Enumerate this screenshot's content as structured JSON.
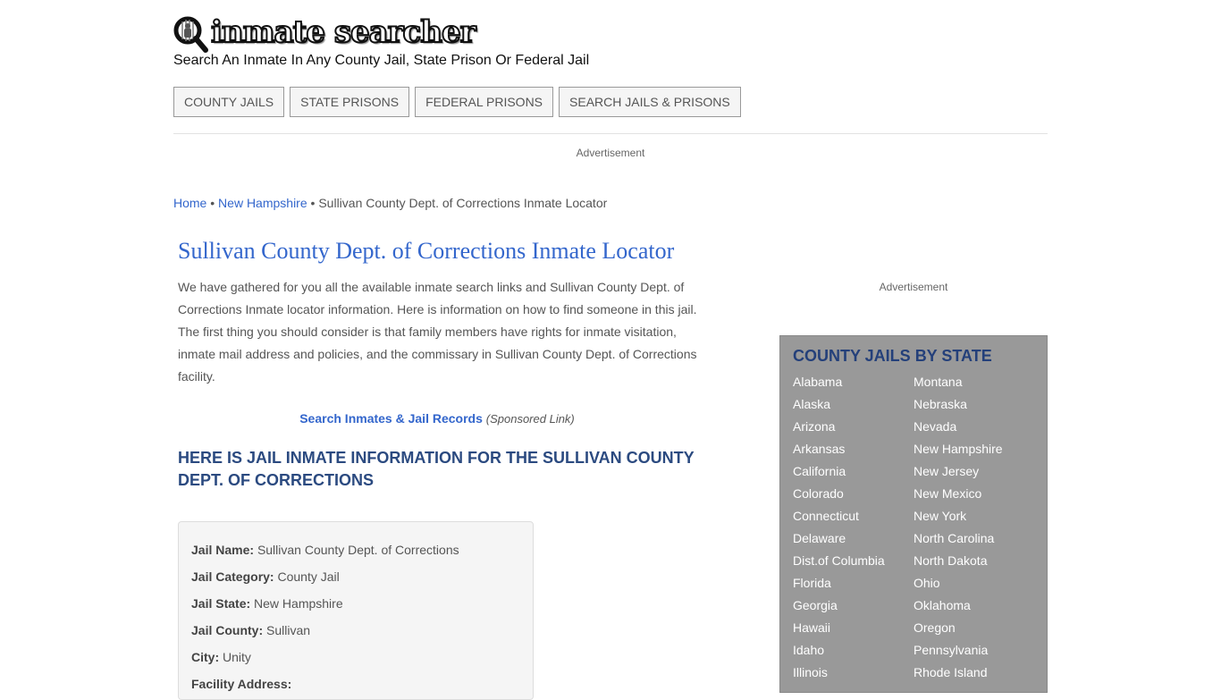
{
  "header": {
    "logo_text": "inmate searcher",
    "tagline": "Search An Inmate In Any County Jail, State Prison Or Federal Jail"
  },
  "nav": {
    "items": [
      "COUNTY JAILS",
      "STATE PRISONS",
      "FEDERAL PRISONS",
      "SEARCH JAILS & PRISONS"
    ]
  },
  "ads": {
    "top_label": "Advertisement",
    "side_label": "Advertisement"
  },
  "breadcrumb": {
    "home": "Home",
    "state": "New Hampshire",
    "separator": "•",
    "current": "Sullivan County Dept. of Corrections Inmate Locator"
  },
  "main": {
    "title": "Sullivan County Dept. of Corrections Inmate Locator",
    "intro": "We have gathered for you all the available inmate search links and Sullivan County Dept. of Corrections Inmate locator information. Here is information on how to find someone in this jail. The first thing you should consider is that family members have rights for inmate visitation, inmate mail address and policies, and the commissary in Sullivan County Dept. of Corrections facility.",
    "sponsored_link": "Search Inmates & Jail Records",
    "sponsored_note": "(Sponsored Link)",
    "section_heading": "HERE IS JAIL INMATE INFORMATION FOR THE SULLIVAN COUNTY DEPT. OF CORRECTIONS",
    "info": [
      {
        "label": "Jail Name:",
        "value": "Sullivan County Dept. of Corrections"
      },
      {
        "label": "Jail Category:",
        "value": "County Jail"
      },
      {
        "label": "Jail State:",
        "value": "New Hampshire"
      },
      {
        "label": "Jail County:",
        "value": "Sullivan"
      },
      {
        "label": "City:",
        "value": "Unity"
      },
      {
        "label": "Facility Address:",
        "value": ""
      }
    ]
  },
  "sidebar": {
    "title": "COUNTY JAILS BY STATE",
    "col1": [
      "Alabama",
      "Alaska",
      "Arizona",
      "Arkansas",
      "California",
      "Colorado",
      "Connecticut",
      "Delaware",
      "Dist.of Columbia",
      "Florida",
      "Georgia",
      "Hawaii",
      "Idaho",
      "Illinois"
    ],
    "col2": [
      "Montana",
      "Nebraska",
      "Nevada",
      "New Hampshire",
      "New Jersey",
      "New Mexico",
      "New York",
      "North Carolina",
      "North Dakota",
      "Ohio",
      "Oklahoma",
      "Oregon",
      "Pennsylvania",
      "Rhode Island"
    ]
  },
  "colors": {
    "link": "#3366cc",
    "heading": "#2b4a80",
    "sidebar_bg": "#999999",
    "sidebar_title": "#24407a"
  }
}
